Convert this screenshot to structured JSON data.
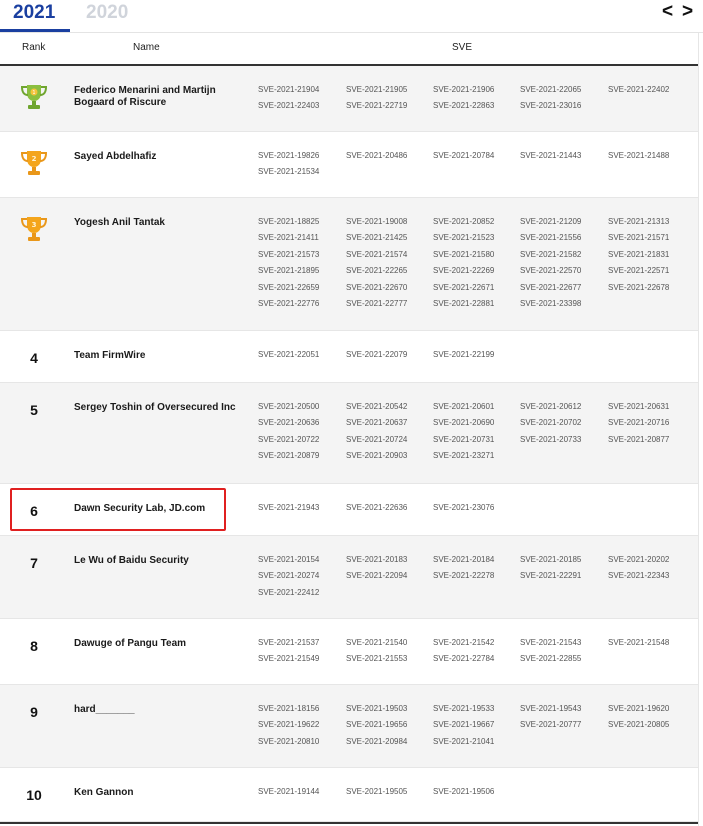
{
  "tabs": [
    {
      "label": "2021",
      "active": true
    },
    {
      "label": "2020",
      "active": false
    }
  ],
  "nav": {
    "prev_icon": "chevron-left-icon",
    "next_icon": "chevron-right-icon",
    "prev": "<",
    "next": ">"
  },
  "header": {
    "rank": "Rank",
    "name": "Name",
    "sve": "SVE"
  },
  "colors": {
    "accent": "#1a3fa0",
    "highlight": "#e02020",
    "gold": "#f4a51c",
    "green_trophy": "#7bb338"
  },
  "rows": [
    {
      "rank": "1",
      "trophy": "green-trophy-icon",
      "name": "Federico Menarini and Martijn Bogaard of Riscure",
      "sves": [
        "SVE-2021-21904",
        "SVE-2021-21905",
        "SVE-2021-21906",
        "SVE-2021-22065",
        "SVE-2021-22402",
        "SVE-2021-22403",
        "SVE-2021-22719",
        "SVE-2021-22863",
        "SVE-2021-23016"
      ]
    },
    {
      "rank": "2",
      "trophy": "gold-trophy-icon",
      "name": "Sayed Abdelhafiz",
      "sves": [
        "SVE-2021-19826",
        "SVE-2021-20486",
        "SVE-2021-20784",
        "SVE-2021-21443",
        "SVE-2021-21488",
        "SVE-2021-21534"
      ]
    },
    {
      "rank": "3",
      "trophy": "gold-trophy-icon",
      "name": "Yogesh Anil Tantak",
      "sves": [
        "SVE-2021-18825",
        "SVE-2021-19008",
        "SVE-2021-20852",
        "SVE-2021-21209",
        "SVE-2021-21313",
        "SVE-2021-21411",
        "SVE-2021-21425",
        "SVE-2021-21523",
        "SVE-2021-21556",
        "SVE-2021-21571",
        "SVE-2021-21573",
        "SVE-2021-21574",
        "SVE-2021-21580",
        "SVE-2021-21582",
        "SVE-2021-21831",
        "SVE-2021-21895",
        "SVE-2021-22265",
        "SVE-2021-22269",
        "SVE-2021-22570",
        "SVE-2021-22571",
        "SVE-2021-22659",
        "SVE-2021-22670",
        "SVE-2021-22671",
        "SVE-2021-22677",
        "SVE-2021-22678",
        "SVE-2021-22776",
        "SVE-2021-22777",
        "SVE-2021-22881",
        "SVE-2021-23398"
      ]
    },
    {
      "rank": "4",
      "name": "Team FirmWire",
      "sves": [
        "SVE-2021-22051",
        "SVE-2021-22079",
        "SVE-2021-22199"
      ]
    },
    {
      "rank": "5",
      "name": "Sergey Toshin of Oversecured Inc",
      "sves": [
        "SVE-2021-20500",
        "SVE-2021-20542",
        "SVE-2021-20601",
        "SVE-2021-20612",
        "SVE-2021-20631",
        "SVE-2021-20636",
        "SVE-2021-20637",
        "SVE-2021-20690",
        "SVE-2021-20702",
        "SVE-2021-20716",
        "SVE-2021-20722",
        "SVE-2021-20724",
        "SVE-2021-20731",
        "SVE-2021-20733",
        "SVE-2021-20877",
        "SVE-2021-20879",
        "SVE-2021-20903",
        "SVE-2021-23271"
      ]
    },
    {
      "rank": "6",
      "name": "Dawn Security Lab, JD.com",
      "sves": [
        "SVE-2021-21943",
        "SVE-2021-22636",
        "SVE-2021-23076"
      ]
    },
    {
      "rank": "7",
      "name": "Le Wu of Baidu Security",
      "sves": [
        "SVE-2021-20154",
        "SVE-2021-20183",
        "SVE-2021-20184",
        "SVE-2021-20185",
        "SVE-2021-20202",
        "SVE-2021-20274",
        "SVE-2021-22094",
        "SVE-2021-22278",
        "SVE-2021-22291",
        "SVE-2021-22343",
        "SVE-2021-22412"
      ]
    },
    {
      "rank": "8",
      "name": "Dawuge of Pangu Team",
      "sves": [
        "SVE-2021-21537",
        "SVE-2021-21540",
        "SVE-2021-21542",
        "SVE-2021-21543",
        "SVE-2021-21548",
        "SVE-2021-21549",
        "SVE-2021-21553",
        "SVE-2021-22784",
        "SVE-2021-22855"
      ]
    },
    {
      "rank": "9",
      "name": "hard_______",
      "sves": [
        "SVE-2021-18156",
        "SVE-2021-19503",
        "SVE-2021-19533",
        "SVE-2021-19543",
        "SVE-2021-19620",
        "SVE-2021-19622",
        "SVE-2021-19656",
        "SVE-2021-19667",
        "SVE-2021-20777",
        "SVE-2021-20805",
        "SVE-2021-20810",
        "SVE-2021-20984",
        "SVE-2021-21041"
      ]
    },
    {
      "rank": "10",
      "name": "Ken Gannon",
      "sves": [
        "SVE-2021-19144",
        "SVE-2021-19505",
        "SVE-2021-19506"
      ]
    }
  ]
}
